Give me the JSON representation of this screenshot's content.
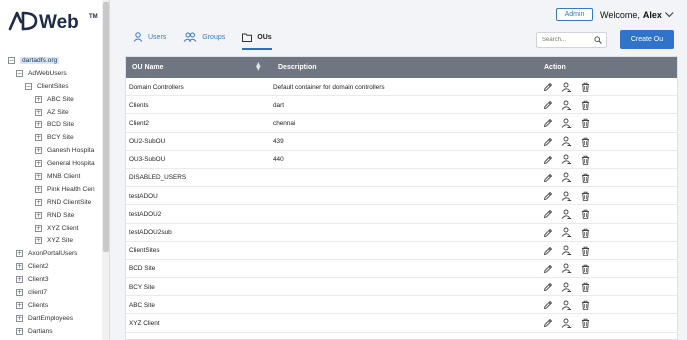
{
  "brand": {
    "logo_text": "ADWeb",
    "trademark": "TM"
  },
  "sidebar": {
    "tree": [
      {
        "label": "dartadfs.org",
        "sign": "−",
        "level": 0,
        "selected": true
      },
      {
        "label": "AdWebUsers",
        "sign": "−",
        "level": 1
      },
      {
        "label": "ClientSites",
        "sign": "−",
        "level": 2
      },
      {
        "label": "ABC Site",
        "sign": "+",
        "level": 3
      },
      {
        "label": "AZ Site",
        "sign": "+",
        "level": 3
      },
      {
        "label": "BCD Site",
        "sign": "+",
        "level": 3
      },
      {
        "label": "BCY Site",
        "sign": "+",
        "level": 3
      },
      {
        "label": "Ganesh Hospita",
        "sign": "+",
        "level": 3
      },
      {
        "label": "General Hospita",
        "sign": "+",
        "level": 3
      },
      {
        "label": "MNB Client",
        "sign": "+",
        "level": 3
      },
      {
        "label": "Pink Health Cen",
        "sign": "+",
        "level": 3
      },
      {
        "label": "RND ClientSite",
        "sign": "+",
        "level": 3
      },
      {
        "label": "RND Site",
        "sign": "+",
        "level": 3
      },
      {
        "label": "XYZ Client",
        "sign": "+",
        "level": 3
      },
      {
        "label": "XYZ Site",
        "sign": "+",
        "level": 3
      },
      {
        "label": "AxonPortalUsers",
        "sign": "+",
        "level": 1
      },
      {
        "label": "Client2",
        "sign": "+",
        "level": 1
      },
      {
        "label": "Client3",
        "sign": "+",
        "level": 1
      },
      {
        "label": "client7",
        "sign": "+",
        "level": 1
      },
      {
        "label": "Clients",
        "sign": "+",
        "level": 1
      },
      {
        "label": "DartEmployees",
        "sign": "+",
        "level": 1
      },
      {
        "label": "Dartians",
        "sign": "+",
        "level": 1
      }
    ]
  },
  "header": {
    "admin_label": "Admin",
    "welcome_text": "Welcome,",
    "user_name": "Alex"
  },
  "tabs": [
    {
      "label": "Users",
      "icon": "user-icon",
      "active": false
    },
    {
      "label": "Groups",
      "icon": "group-icon",
      "active": false
    },
    {
      "label": "OUs",
      "icon": "folder-icon",
      "active": true
    }
  ],
  "search": {
    "placeholder": "Search..."
  },
  "create_button": "Create Ou",
  "table": {
    "columns": {
      "name": "OU Name",
      "description": "Description",
      "action": "Action"
    },
    "rows": [
      {
        "name": "Domain Controllers",
        "description": "Default container for domain controllers"
      },
      {
        "name": "Clients",
        "description": "dart"
      },
      {
        "name": "Client2",
        "description": "chennai"
      },
      {
        "name": "OU2-SubOU",
        "description": "439"
      },
      {
        "name": "OU3-SubOU",
        "description": "440"
      },
      {
        "name": "DISABLED_USERS",
        "description": ""
      },
      {
        "name": "testADOU",
        "description": ""
      },
      {
        "name": "testADOU2",
        "description": ""
      },
      {
        "name": "testADOU2sub",
        "description": ""
      },
      {
        "name": "ClientSites",
        "description": ""
      },
      {
        "name": "BCD Site",
        "description": ""
      },
      {
        "name": "BCY Site",
        "description": ""
      },
      {
        "name": "ABC Site",
        "description": ""
      },
      {
        "name": "XYZ Client",
        "description": ""
      }
    ],
    "row_actions": [
      "edit-icon",
      "manage-user-icon",
      "delete-icon"
    ]
  },
  "colors": {
    "accent": "#2f74c9",
    "header_bg": "#6e7682",
    "selected_bg": "#dbe6f3"
  }
}
